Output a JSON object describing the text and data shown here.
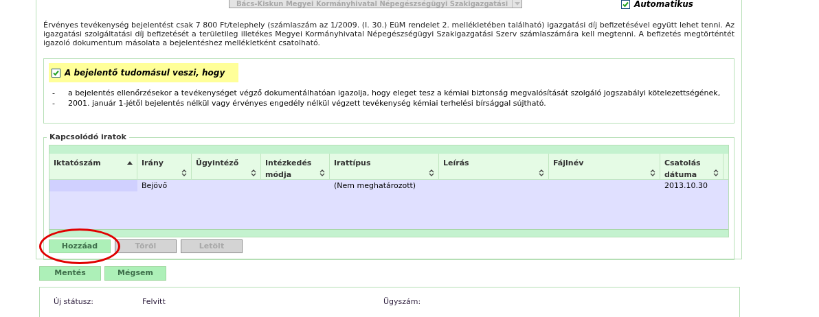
{
  "top_row": {
    "dropdown_value": "Bács-Kiskun Megyei Kormányhivatal Népegészségügyi Szakigazgatási",
    "automatic": {
      "label": "Automatikus",
      "checked": true
    }
  },
  "fee_notice": "Érvényes tevékenység bejelentést csak 7 800 Ft/telephely (számlaszám az 1/2009. (I. 30.) EüM rendelet 2. mellékletében található) igazgatási díj befizetésével együtt lehet tenni. Az igazgatási szolgáltatási díj befizetését a területileg illetékes Megyei Kormányhivatal Népegészségügyi Szakigazgatási Szerv számlaszámára kell megtenni. A befizetés megtörténtét igazoló dokumentum másolata a bejelentéshez mellékletként csatolható.",
  "acknowledgement": {
    "label": "A bejelentő tudomásul veszi, hogy",
    "checked": true,
    "items": [
      {
        "marker": "-",
        "text": "a bejelentés ellenőrzésekor a tevékenységet végző dokumentálhatóan igazolja, hogy eleget tesz a kémiai biztonság megvalósítását szolgáló jogszabályi kötelezettségének,"
      },
      {
        "marker": "-",
        "text": "2001. január 1-jétől bejelentés nélkül vagy érvényes engedély nélkül végzett tevékenység kémiai terhelési bírsággal sújtható."
      }
    ]
  },
  "related_documents": {
    "legend": "Kapcsolódó iratok",
    "table": {
      "columns": [
        {
          "label": "Iktatószám",
          "sorted": true
        },
        {
          "label": "Irány",
          "sorted": false
        },
        {
          "label": "Ügyintéző",
          "sorted": false
        },
        {
          "label": "Intézkedés módja",
          "sorted": false
        },
        {
          "label": "Irattípus",
          "sorted": false
        },
        {
          "label": "Leírás",
          "sorted": false
        },
        {
          "label": "Fájlnév",
          "sorted": false
        },
        {
          "label": "Csatolás dátuma",
          "sorted": false
        }
      ],
      "rows": [
        [
          "",
          "Bejövő",
          "",
          "",
          "(Nem meghatározott)",
          "",
          "",
          "2013.10.30"
        ]
      ]
    },
    "buttons": [
      {
        "label": "Hozzáad",
        "disabled": false,
        "highlighted": true
      },
      {
        "label": "Töröl",
        "disabled": true,
        "highlighted": false
      },
      {
        "label": "Letölt",
        "disabled": true,
        "highlighted": false
      }
    ]
  },
  "form_buttons": [
    {
      "label": "Mentés",
      "disabled": false
    },
    {
      "label": "Mégsem",
      "disabled": false
    }
  ],
  "status_panel": {
    "fields": [
      {
        "label": "Új státusz:",
        "value": "Felvitt"
      },
      {
        "label": "Ügyszám:"
      }
    ]
  }
}
